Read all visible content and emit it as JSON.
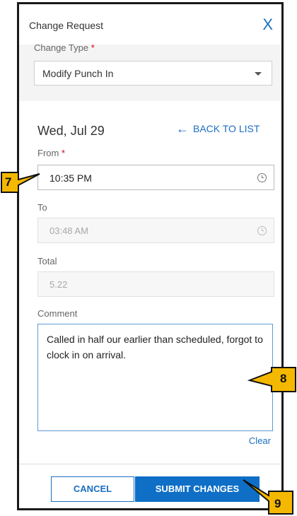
{
  "dialog": {
    "title": "Change Request",
    "close_glyph": "X"
  },
  "change_type": {
    "label": "Change Type",
    "required_mark": "*",
    "value": "Modify Punch In"
  },
  "date": "Wed, Jul 29",
  "back_link": {
    "arrow": "←",
    "label": "BACK TO LIST"
  },
  "from": {
    "label": "From",
    "required_mark": "*",
    "value": "10:35 PM"
  },
  "to": {
    "label": "To",
    "value": "03:48 AM"
  },
  "total": {
    "label": "Total",
    "value": "5.22"
  },
  "comment": {
    "label": "Comment",
    "text": "Called in half our earlier than scheduled, forgot to clock in on arrival."
  },
  "clear_label": "Clear",
  "buttons": {
    "cancel": "CANCEL",
    "submit": "SUBMIT CHANGES"
  },
  "callouts": {
    "c7": "7",
    "c8": "8",
    "c9": "9"
  },
  "colors": {
    "accent": "#1b6ec2",
    "callout_fill": "#f5b800",
    "required": "#d0021b"
  }
}
